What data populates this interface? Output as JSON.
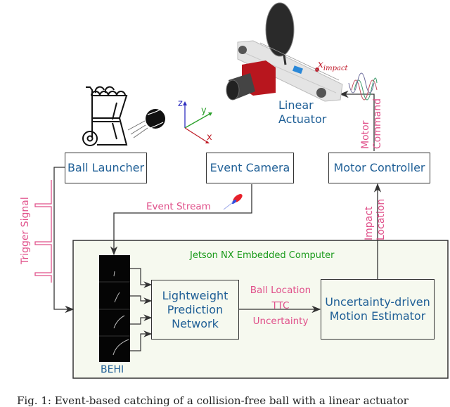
{
  "blocks": {
    "ball_launcher": "Ball Launcher",
    "event_camera": "Event Camera",
    "motor_controller": "Motor Controller",
    "embedded_computer": "Jetson NX Embedded Computer",
    "prediction_network": [
      "Lightweight",
      "Prediction",
      "Network"
    ],
    "motion_estimator": [
      "Uncertainty-driven",
      "Motion Estimator"
    ],
    "behi": "BEHI",
    "linear_actuator": [
      "Linear",
      "Actuator"
    ]
  },
  "signals": {
    "trigger_signal": "Trigger Signal",
    "event_stream": "Event Stream",
    "motor_command": [
      "Motor",
      "Command"
    ],
    "impact_location": [
      "Impact",
      "Location"
    ],
    "network_outputs": [
      "Ball Location",
      "TTC",
      "Uncertainty"
    ]
  },
  "annotations": {
    "x_impact": "x",
    "x_impact_sub": "impact",
    "axis_z": "z",
    "axis_y": "y",
    "axis_x": "x"
  },
  "caption": "Fig. 1:  Event-based  catching  of  a  collision-free  ball  with  a  linear  actuator",
  "colors": {
    "block_text": "#1f5f96",
    "signal_text": "#e0508a",
    "computer_label": "#1a9a1a",
    "computer_bg": "#f6f9ef",
    "axis_x": "#c0202a",
    "axis_y": "#2aa02a",
    "axis_z": "#3030c0"
  }
}
